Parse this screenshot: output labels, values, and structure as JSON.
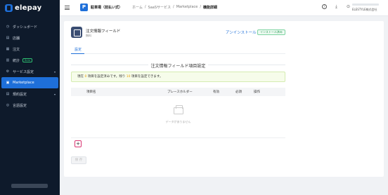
{
  "app": {
    "logo_text": "elepay"
  },
  "sidebar": {
    "items": [
      {
        "label": "ダッシュボード",
        "icon": "dashboard-icon"
      },
      {
        "label": "店舗",
        "icon": "store-icon"
      },
      {
        "label": "注文",
        "icon": "order-icon"
      },
      {
        "label": "統計",
        "icon": "chart-icon",
        "badge": "Beta"
      },
      {
        "label": "サービス設定",
        "icon": "gear-icon"
      },
      {
        "label": "Marketplace",
        "icon": "marketplace-icon",
        "active": true
      },
      {
        "label": "規約設定",
        "icon": "document-icon"
      },
      {
        "label": "言語設定",
        "icon": "globe-icon"
      }
    ]
  },
  "topbar": {
    "shop_initial": "P",
    "shop_name": "駐車場（前払い式）",
    "breadcrumbs": [
      "ホーム",
      "/",
      "SaaSサービス",
      "/",
      "Marketplace",
      "/",
      "機能詳細"
    ],
    "help_icon_text": "?",
    "download_icon_text": "⤓",
    "user_icon_text": "⊙",
    "user_company": "ELESTYLE株式会社"
  },
  "plugin": {
    "title": "注文情報フィールド",
    "subtitle": "無料",
    "uninstall_label": "アンインストール",
    "installed_label": "インストール済み"
  },
  "tabs": {
    "settings": "設定"
  },
  "section": {
    "title": "注文情報フィールド項目設定"
  },
  "notice": {
    "prefix": "現在",
    "current": "0",
    "middle": "項目を設定済みです。残り",
    "remaining": "10",
    "suffix": "項目を設定できます。"
  },
  "table": {
    "headers": [
      "項目名",
      "プレースホルダー",
      "有効",
      "必須",
      "操作"
    ],
    "empty_text": "データがありません"
  },
  "buttons": {
    "add": "+",
    "save": "保 存"
  },
  "colors": {
    "accent": "#1e6fd9",
    "sidebar_bg": "#0e1a2b",
    "add_border": "#d93572"
  }
}
